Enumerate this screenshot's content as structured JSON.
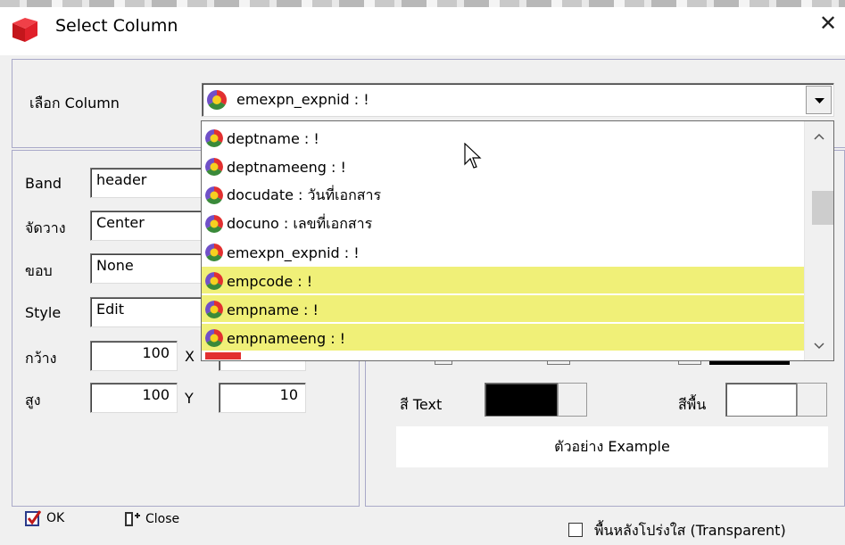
{
  "window": {
    "title": "Select Column",
    "close": "✕"
  },
  "column_select": {
    "label": "เลือก Column",
    "selected": "emexpn_expnid : !"
  },
  "dropdown": {
    "items": [
      "deptname : !",
      "deptnameeng : !",
      "docudate : วันที่เอกสาร",
      "docuno : เลขที่เอกสาร",
      "emexpn_expnid : !",
      "empcode : !",
      "empname : !",
      "empnameeng : !"
    ],
    "highlighted": [
      "empcode : !",
      "empname : !",
      "empnameeng : !"
    ]
  },
  "props": {
    "band": {
      "label": "Band",
      "value": "header"
    },
    "align": {
      "label": "จัดวาง",
      "value": "Center"
    },
    "border": {
      "label": "ขอบ",
      "value": "None"
    },
    "style": {
      "label": "Style",
      "value": "Edit"
    },
    "width": {
      "label": "กว้าง",
      "value": "100",
      "x_label": "X",
      "x_value": ""
    },
    "height": {
      "label": "สูง",
      "value": "100",
      "y_label": "Y",
      "y_value": "10"
    }
  },
  "colors": {
    "text_label": "สี Text",
    "text_color": "#000000",
    "bg_label": "สีพื้น",
    "bg_color": "#ffffff",
    "example": "ตัวอย่าง Example"
  },
  "footer": {
    "ok": "OK",
    "close": "Close",
    "transparent": "พื้นหลังโปร่งใส (Transparent)"
  }
}
